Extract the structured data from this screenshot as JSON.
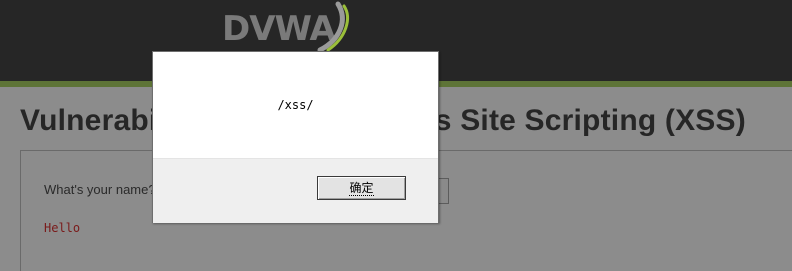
{
  "header": {
    "logo_text": "DVWA",
    "background": "#262626",
    "accent_bar_color": "#5e7437"
  },
  "page": {
    "title": "Vulnerability: Reflected Cross Site Scripting (XSS)",
    "form_label": "What's your name?",
    "output_text": "Hello",
    "output_color": "#7a1a1a"
  },
  "dialog": {
    "message": "/xss/",
    "ok_label": "确定"
  }
}
